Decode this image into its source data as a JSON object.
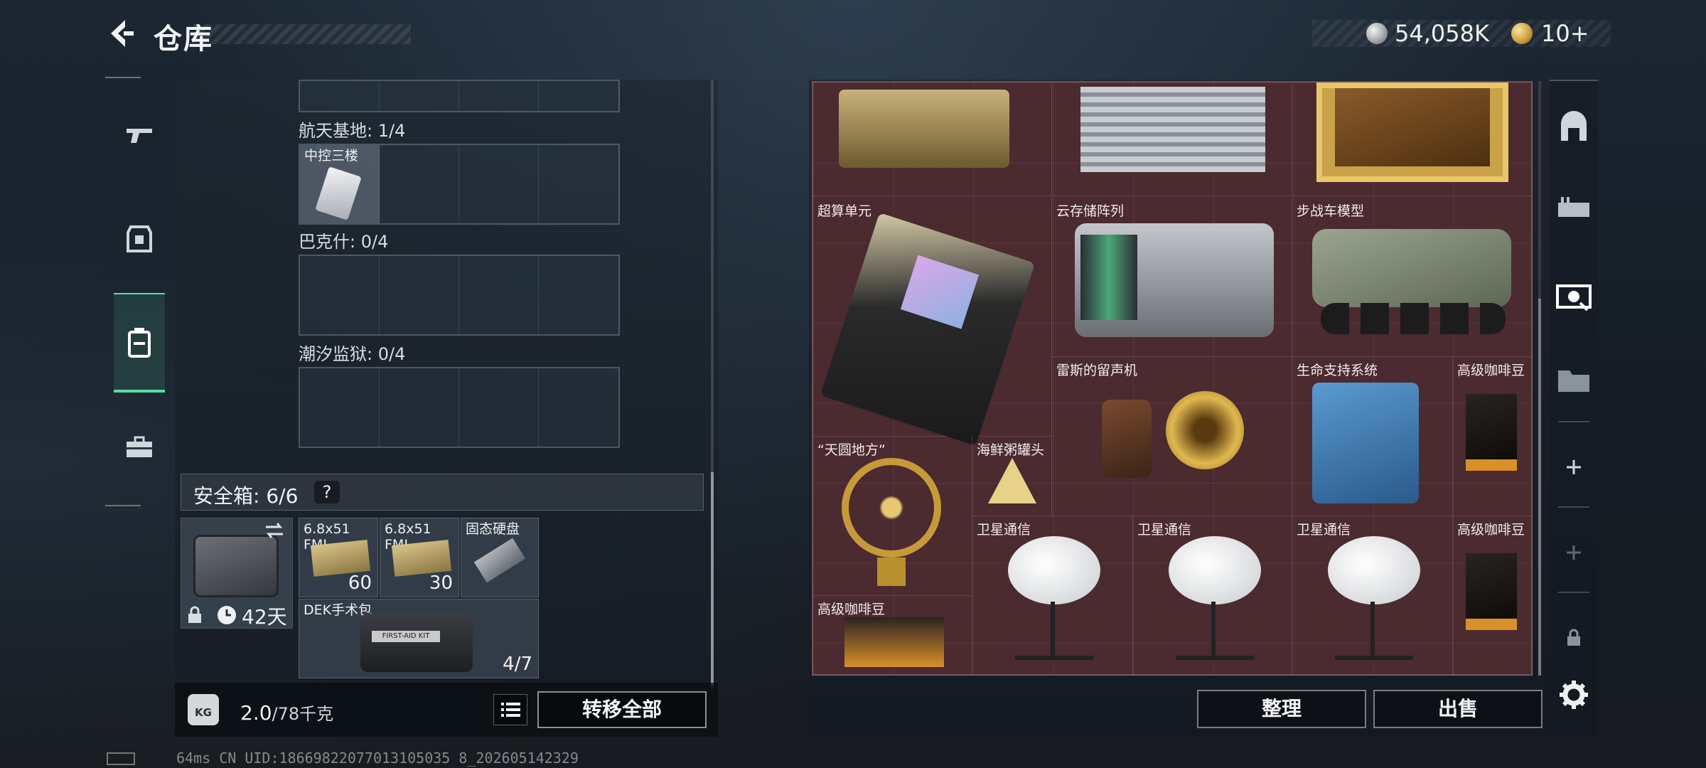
{
  "header": {
    "title": "仓库",
    "currency_silver": "54,058K",
    "currency_gold": "10+"
  },
  "left_panel": {
    "sections": [
      {
        "label": "航天基地: 1/4",
        "items": [
          {
            "name": "中控三楼"
          }
        ]
      },
      {
        "label": "巴克什: 0/4",
        "items": []
      },
      {
        "label": "潮汐监狱: 0/4",
        "items": []
      }
    ],
    "safe_box": {
      "label": "安全箱: 6/6",
      "help": "?",
      "days": "42天",
      "items": [
        {
          "name": "6.8x51 FMJ",
          "count": "60"
        },
        {
          "name": "6.8x51 FMJ",
          "count": "30"
        },
        {
          "name": "固态硬盘",
          "count": ""
        },
        {
          "name": "DEK手术包",
          "count": "4/7",
          "print": "FIRST-AID KIT"
        }
      ]
    },
    "weight": {
      "current": "2.0",
      "max": "/78千克",
      "icon_text": "KG"
    },
    "transfer_all_label": "转移全部"
  },
  "right_panel": {
    "items": [
      {
        "name": "超算单元"
      },
      {
        "name": "云存储阵列"
      },
      {
        "name": "步战车模型"
      },
      {
        "name": "雷斯的留声机"
      },
      {
        "name": "生命支持系统"
      },
      {
        "name": "高级咖啡豆"
      },
      {
        "name": "“天圆地方”"
      },
      {
        "name": "海鲜粥罐头"
      },
      {
        "name": "卫星通信"
      },
      {
        "name": "卫星通信"
      },
      {
        "name": "卫星通信"
      },
      {
        "name": "高级咖啡豆"
      },
      {
        "name": "高级咖啡豆"
      }
    ],
    "organize_label": "整理",
    "sell_label": "出售"
  },
  "status": {
    "text": "64ms    CN UID:18669822077013105035 8_202605142329"
  },
  "colors": {
    "accent_green": "#53e0a0",
    "item_grid_bg": "#4b2a30"
  },
  "icons": [
    "back-arrow-icon",
    "weapon-icon",
    "armor-icon",
    "storage-icon",
    "briefcase-icon",
    "gear-icon",
    "lock-icon",
    "clock-icon",
    "swap-icon",
    "list-icon",
    "plus-icon"
  ]
}
